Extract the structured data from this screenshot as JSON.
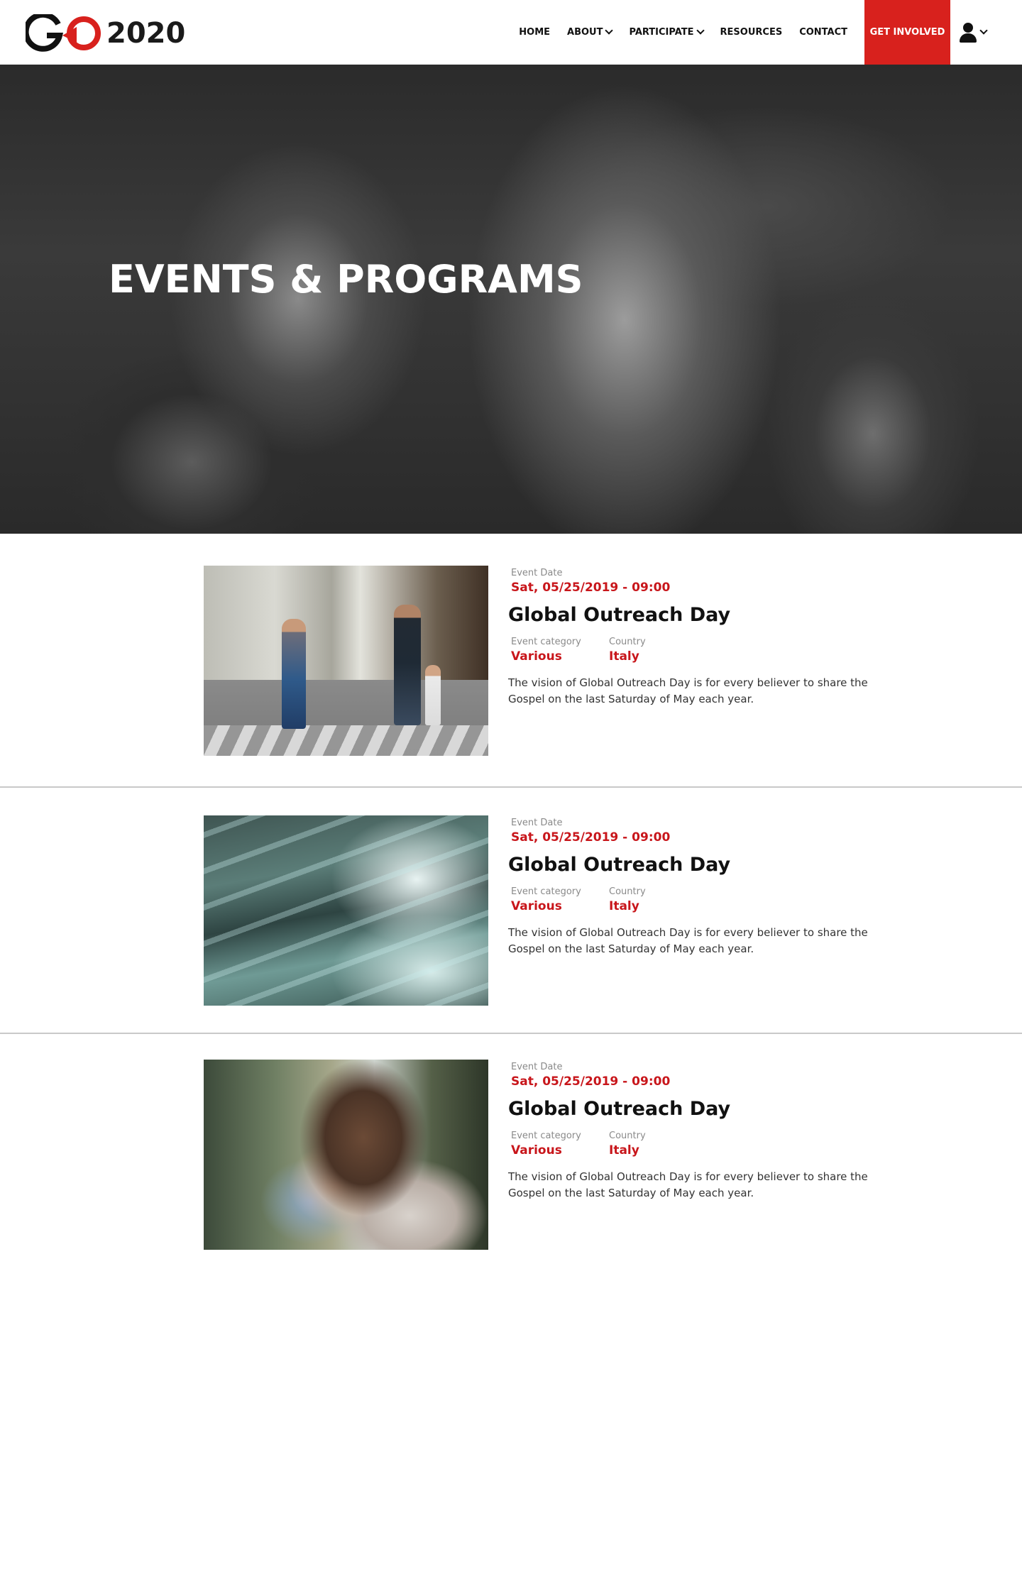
{
  "brand": {
    "logo_text": "2020",
    "accent_color": "#d8211d",
    "date_color": "#c8161b"
  },
  "nav": {
    "items": [
      {
        "label": "HOME",
        "dropdown": false
      },
      {
        "label": "ABOUT",
        "dropdown": true
      },
      {
        "label": "PARTICIPATE",
        "dropdown": true
      },
      {
        "label": "RESOURCES",
        "dropdown": false
      },
      {
        "label": "CONTACT",
        "dropdown": false
      }
    ],
    "cta_label": "GET INVOLVED",
    "user_menu_icon": "user-icon"
  },
  "hero": {
    "title": "EVENTS & PROGRAMS"
  },
  "events": [
    {
      "date_label": "Event Date",
      "date": "Sat, 05/25/2019 - 09:00",
      "title": "Global Outreach Day",
      "category_label": "Event category",
      "category": "Various",
      "country_label": "Country",
      "country": "Italy",
      "description": "The vision of Global Outreach Day is for every believer to share the Gospel on the last Saturday of May each year."
    },
    {
      "date_label": "Event Date",
      "date": "Sat, 05/25/2019 - 09:00",
      "title": "Global Outreach Day",
      "category_label": "Event category",
      "category": "Various",
      "country_label": "Country",
      "country": "Italy",
      "description": "The vision of Global Outreach Day is for every believer to share the Gospel on the last Saturday of May each year."
    },
    {
      "date_label": "Event Date",
      "date": "Sat, 05/25/2019 - 09:00",
      "title": "Global Outreach Day",
      "category_label": "Event category",
      "category": "Various",
      "country_label": "Country",
      "country": "Italy",
      "description": "The vision of Global Outreach Day is for every believer to share the Gospel on the last Saturday of May each year."
    }
  ]
}
